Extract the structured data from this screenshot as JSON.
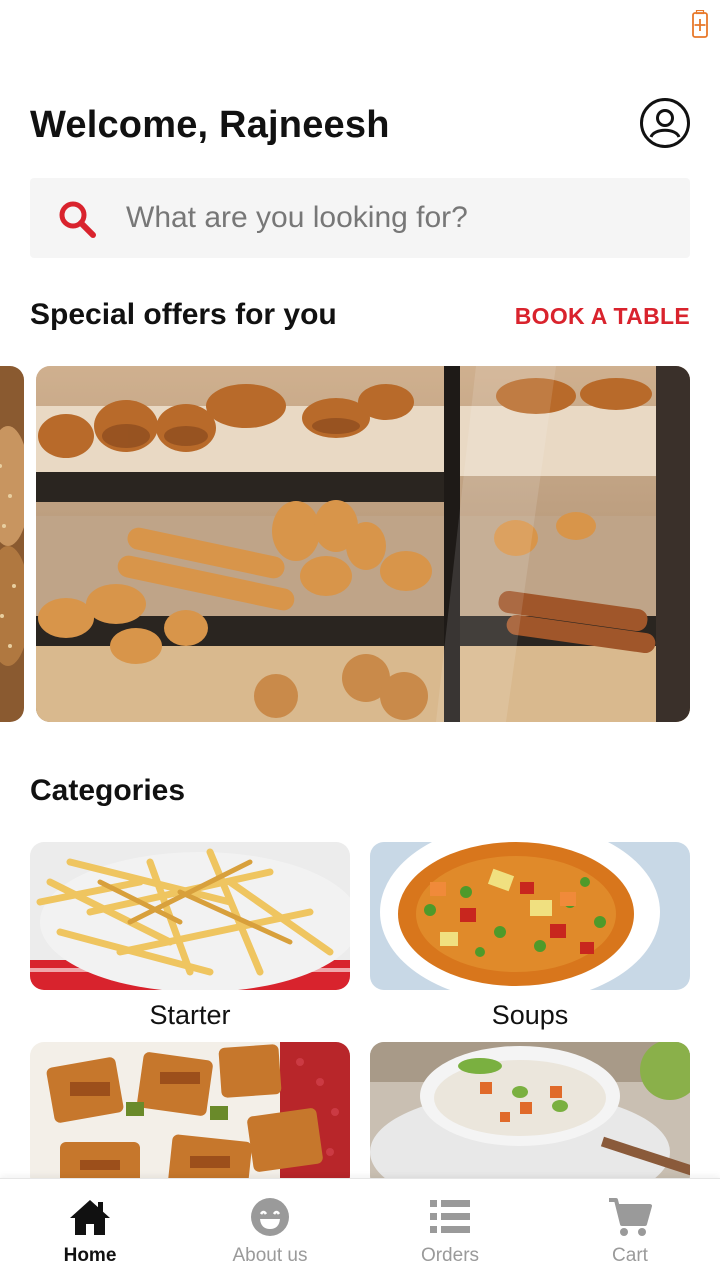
{
  "header": {
    "welcome_text": "Welcome, Rajneesh"
  },
  "search": {
    "placeholder": "What are you looking for?"
  },
  "offers": {
    "title": "Special offers for you",
    "action_label": "BOOK A TABLE"
  },
  "categories": {
    "title": "Categories",
    "items": [
      {
        "label": "Starter"
      },
      {
        "label": "Soups"
      },
      {
        "label": ""
      },
      {
        "label": ""
      }
    ]
  },
  "bottom_nav": {
    "items": [
      {
        "label": "Home",
        "icon": "home-icon",
        "active": true
      },
      {
        "label": "About us",
        "icon": "smiley-icon",
        "active": false
      },
      {
        "label": "Orders",
        "icon": "list-icon",
        "active": false
      },
      {
        "label": "Cart",
        "icon": "cart-icon",
        "active": false
      }
    ]
  },
  "colors": {
    "accent": "#d9232d",
    "text": "#111111",
    "inactive": "#9a9a9a",
    "search_bg": "#f5f5f5"
  }
}
